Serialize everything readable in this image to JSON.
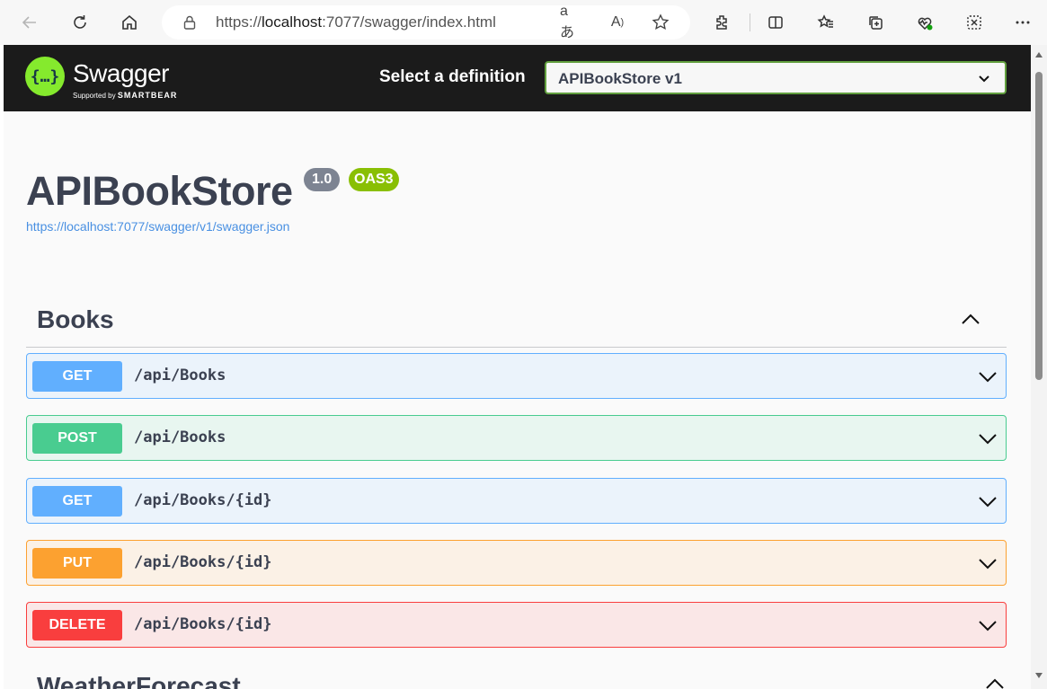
{
  "browser": {
    "url_prefix": "https://",
    "url_host": "localhost",
    "url_rest": ":7077/swagger/index.html"
  },
  "topbar": {
    "logo_title": "Swagger",
    "logo_sub_prefix": "Supported by",
    "logo_sub_brand": "SMARTBEAR",
    "select_label": "Select a definition",
    "selected_definition": "APIBookStore v1"
  },
  "info": {
    "title": "APIBookStore",
    "version": "1.0",
    "oas_badge": "OAS3",
    "spec_url": "https://localhost:7077/swagger/v1/swagger.json"
  },
  "tags": [
    {
      "name": "Books",
      "operations": [
        {
          "method": "GET",
          "path": "/api/Books",
          "color": "#61affe"
        },
        {
          "method": "POST",
          "path": "/api/Books",
          "color": "#49cc90"
        },
        {
          "method": "GET",
          "path": "/api/Books/{id}",
          "color": "#61affe"
        },
        {
          "method": "PUT",
          "path": "/api/Books/{id}",
          "color": "#fca130"
        },
        {
          "method": "DELETE",
          "path": "/api/Books/{id}",
          "color": "#f93e3e"
        }
      ]
    },
    {
      "name": "WeatherForecast"
    }
  ]
}
